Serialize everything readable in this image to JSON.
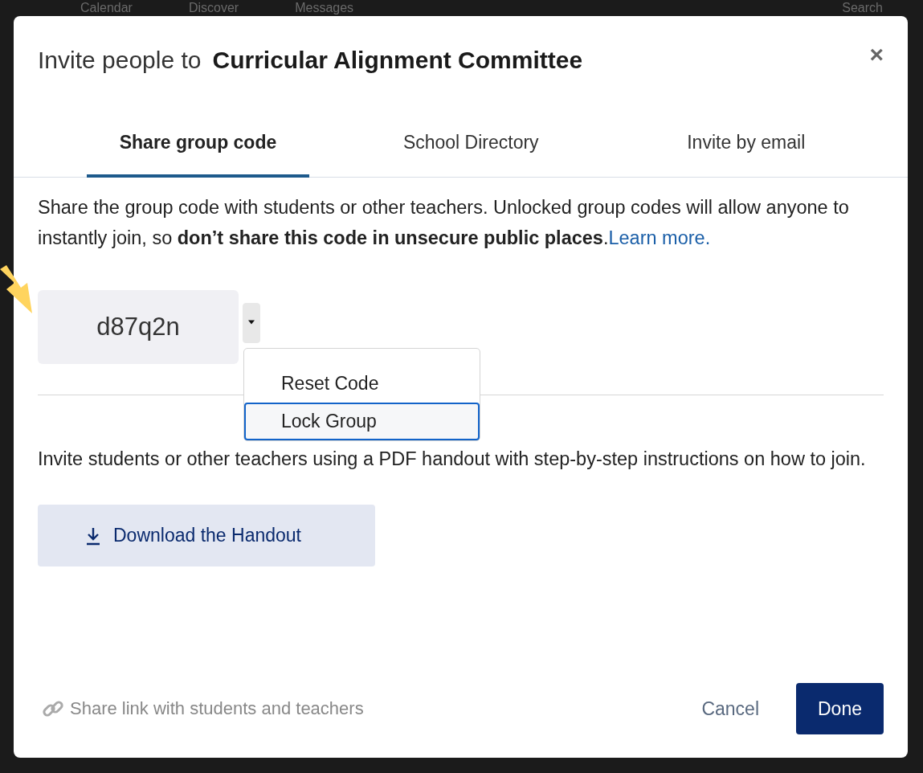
{
  "background_nav": [
    "Calendar",
    "Discover",
    "Messages",
    "Search"
  ],
  "dialog": {
    "title_prefix": "Invite people to",
    "group_name": "Curricular Alignment Committee",
    "close": "×"
  },
  "tabs": [
    {
      "label": "Share group code",
      "selected": true
    },
    {
      "label": "School Directory",
      "selected": false
    },
    {
      "label": "Invite by email",
      "selected": false
    }
  ],
  "intro": "Share the group code with students or other teachers. Unlocked group codes will allow anyone to instantly join, so **don’t share this code in unsecure public places**.",
  "learn_more": "Learn more.",
  "group_code": "d87q2n",
  "code_menu": {
    "expanded": true,
    "items": [
      {
        "label": "Reset Code",
        "selected": false
      },
      {
        "label": "Lock Group",
        "selected": true
      }
    ]
  },
  "handout_text": "Invite students or other teachers using a PDF handout with step-by-step instructions on how to join.",
  "download_button": "Download the Handout",
  "share_link": "Share link with students and teachers",
  "cancel": "Cancel",
  "done": "Done"
}
